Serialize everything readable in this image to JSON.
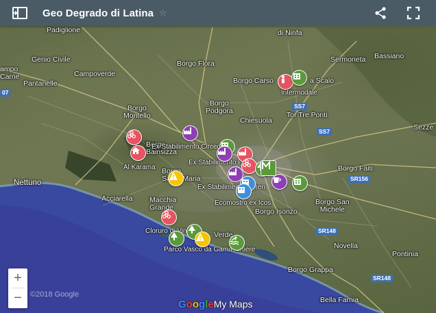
{
  "header": {
    "title": "Geo Degrado di Latina",
    "star_icon": "☆"
  },
  "places": [
    {
      "id": "padiglione",
      "text": "Padiglione"
    },
    {
      "id": "ninfa",
      "text": "di Ninfa"
    },
    {
      "id": "genio-civile",
      "text": "Genio Civile"
    },
    {
      "id": "campo",
      "text": "ampo"
    },
    {
      "id": "arne",
      "text": "Carne"
    },
    {
      "id": "pantanelle",
      "text": "Pantanelle"
    },
    {
      "id": "campoverde",
      "text": "Campoverde"
    },
    {
      "id": "borgo-flora",
      "text": "Borgo Flora"
    },
    {
      "id": "sermoneta",
      "text": "Sermoneta"
    },
    {
      "id": "bassiano",
      "text": "Bassiano"
    },
    {
      "id": "borgo-carso",
      "text": "Borgo Carso"
    },
    {
      "id": "scalo",
      "text": "a Scalo"
    },
    {
      "id": "borgo-podgora",
      "text": "Borgo\nPodgora"
    },
    {
      "id": "borgo-montello",
      "text": "Borgo\nMontello"
    },
    {
      "id": "chiesuola",
      "text": "Chiesuola"
    },
    {
      "id": "tor-tre-ponti",
      "text": "Tor Tre Ponti"
    },
    {
      "id": "sezze",
      "text": "Sezze"
    },
    {
      "id": "borgo-bainsizza",
      "text": "Borgo\nBainsizza"
    },
    {
      "id": "borgo-faiti",
      "text": "Borgo Faiti"
    },
    {
      "id": "nettuno",
      "text": "Nettuno"
    },
    {
      "id": "borgo-santa-maria",
      "text": "Borgo\nSanta Maria"
    },
    {
      "id": "acciarella",
      "text": "Acciarella"
    },
    {
      "id": "borgo-isonzo",
      "text": "Borgo Isonzo"
    },
    {
      "id": "borgo-san-michele",
      "text": "Borgo San\nMichele"
    },
    {
      "id": "macchia-grande",
      "text": "Macchia\nGrande"
    },
    {
      "id": "borgo-verde",
      "text": "Verde"
    },
    {
      "id": "novella",
      "text": "Novella"
    },
    {
      "id": "pontinia",
      "text": "Pontinia"
    },
    {
      "id": "borgo-grappa",
      "text": "Borgo Grappa"
    },
    {
      "id": "bella-farnia",
      "text": "Bella Farnia"
    }
  ],
  "roads": [
    {
      "id": "ss7a",
      "text": "SS7"
    },
    {
      "id": "ss7b",
      "text": "SS7"
    },
    {
      "id": "sr156",
      "text": "SR156"
    },
    {
      "id": "sr148a",
      "text": "SR148"
    },
    {
      "id": "sr148b",
      "text": "SR148"
    },
    {
      "id": "ss7c",
      "text": "07"
    }
  ],
  "poi_labels": {
    "intermodale": "Intermodale",
    "ex_stab_circeo": "Ex Stabilimento Circeo",
    "ex_stab_pozzi": "Ex Stabilimento Pozzi",
    "al_karama": "Al Karama",
    "ex_stab_serenissima": "Ex Stabilimento Seren",
    "ecomostro": "Ecomostro ex Icos",
    "cloruro": "Cloruro di Vinile",
    "parco_vasco": "Parco Vasco da Gama",
    "artiere": "artiere"
  },
  "markers": [
    {
      "id": "intermodale",
      "color": "red",
      "icon": "person-icon"
    },
    {
      "id": "scalo-building",
      "color": "green",
      "icon": "building-icon"
    },
    {
      "id": "bainsizza-biohazard",
      "color": "red",
      "icon": "biohazard-icon"
    },
    {
      "id": "al-karama-house",
      "color": "red",
      "icon": "house-icon"
    },
    {
      "id": "circeo-factory",
      "color": "purple",
      "icon": "factory-icon"
    },
    {
      "id": "circeo-building",
      "color": "green",
      "icon": "building-icon"
    },
    {
      "id": "pozzi-factory",
      "color": "red",
      "icon": "factory-icon"
    },
    {
      "id": "pozzi-factory-2",
      "color": "purple",
      "icon": "factory-icon"
    },
    {
      "id": "latina-biohazard",
      "color": "red",
      "icon": "biohazard-icon"
    },
    {
      "id": "latina-marker-green",
      "color": "green",
      "icon": "tree-icon"
    },
    {
      "id": "latina-m",
      "color": "greenbox",
      "icon": "m-icon"
    },
    {
      "id": "serenissima-factory",
      "color": "purple",
      "icon": "factory-icon"
    },
    {
      "id": "latina-blue",
      "color": "blue",
      "icon": "building-icon"
    },
    {
      "id": "latina-blue-2",
      "color": "blue",
      "icon": "building-icon"
    },
    {
      "id": "latina-coffee",
      "color": "purple",
      "icon": "cup-icon"
    },
    {
      "id": "latina-east-building",
      "color": "green",
      "icon": "building-icon"
    },
    {
      "id": "santa-maria-warning",
      "color": "yellow",
      "icon": "warning-icon"
    },
    {
      "id": "cloruro-biohazard",
      "color": "red",
      "icon": "biohazard-icon"
    },
    {
      "id": "cloruro-tree",
      "color": "green",
      "icon": "tree-icon"
    },
    {
      "id": "parco-tree",
      "color": "green",
      "icon": "tree-icon"
    },
    {
      "id": "parco-warning",
      "color": "yellow",
      "icon": "warning-icon"
    },
    {
      "id": "artiere-pool",
      "color": "green",
      "icon": "swim-icon"
    }
  ],
  "zoom": {
    "in": "+",
    "out": "−"
  },
  "footer": {
    "copyright": "©2018 Google",
    "brand_g": "G",
    "brand_o1": "o",
    "brand_o2": "o",
    "brand_g2": "g",
    "brand_l": "l",
    "brand_e": "e",
    "brand_rest": "My Maps"
  }
}
